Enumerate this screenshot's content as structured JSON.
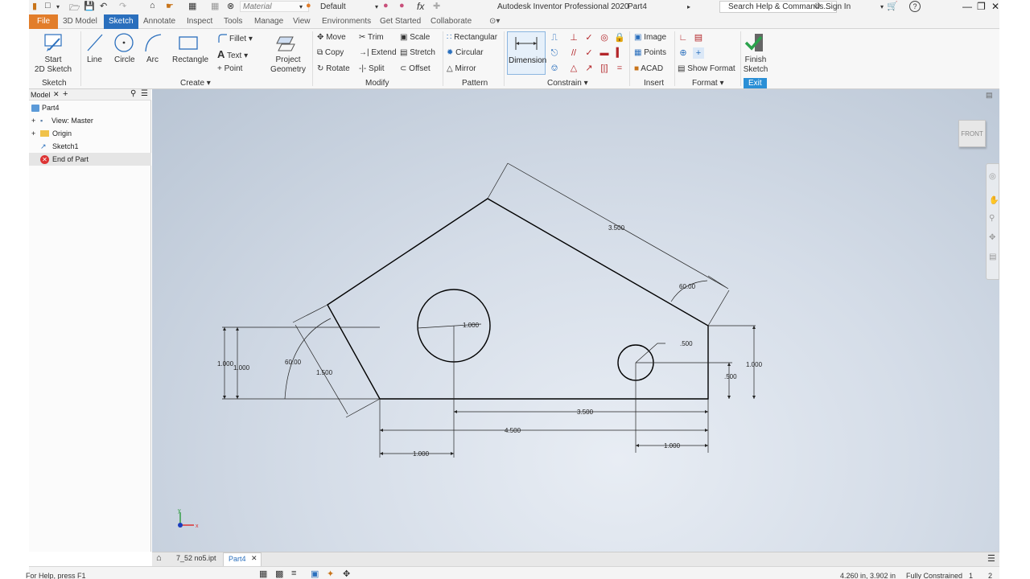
{
  "titlebar": {
    "material": "Material",
    "appearance": "Default",
    "fx": "fx",
    "title": "Autodesk Inventor Professional 2020",
    "document": "Part4",
    "search_placeholder": "Search Help & Commands...",
    "sign_in": "Sign In",
    "help": "?"
  },
  "tabs": [
    "File",
    "3D Model",
    "Sketch",
    "Annotate",
    "Inspect",
    "Tools",
    "Manage",
    "View",
    "Environments",
    "Get Started",
    "Collaborate"
  ],
  "ribbon": {
    "sketch_group": {
      "start_label": "Start",
      "start_label2": "2D Sketch",
      "label": "Sketch"
    },
    "create_group": {
      "line": "Line",
      "circle": "Circle",
      "arc": "Arc",
      "rectangle": "Rectangle",
      "fillet": "Fillet",
      "text": "Text",
      "point": "Point",
      "project": "Project",
      "geometry": "Geometry",
      "label": "Create"
    },
    "modify_group": {
      "move": "Move",
      "trim": "Trim",
      "scale": "Scale",
      "copy": "Copy",
      "extend": "Extend",
      "stretch": "Stretch",
      "rotate": "Rotate",
      "split": "Split",
      "offset": "Offset",
      "label": "Modify"
    },
    "pattern_group": {
      "rectangular": "Rectangular",
      "circular": "Circular",
      "mirror": "Mirror",
      "label": "Pattern"
    },
    "constrain_group": {
      "dimension": "Dimension",
      "label": "Constrain"
    },
    "insert_group": {
      "image": "Image",
      "points": "Points",
      "acad": "ACAD",
      "label": "Insert"
    },
    "format_group": {
      "show_format": "Show Format",
      "label": "Format"
    },
    "exit_group": {
      "finish": "Finish",
      "sketch": "Sketch",
      "label": "Exit"
    }
  },
  "browser": {
    "tab": "Model",
    "items": [
      {
        "label": "Part4"
      },
      {
        "label": "View: Master"
      },
      {
        "label": "Origin"
      },
      {
        "label": "Sketch1"
      },
      {
        "label": "End of Part"
      }
    ]
  },
  "viewcube": {
    "face": "FRONT"
  },
  "sketch": {
    "dims": {
      "d_3500_slant": "3.500",
      "d_60_right": "60.00",
      "d_1000_hole_dia": "1.000",
      "d_500_hole_dia": ".500",
      "d_1000_left_a": "1.000",
      "d_1000_left_b": "1.000",
      "d_60_left": "60.00",
      "d_1500": "1.500",
      "d_500_right": ".500",
      "d_1000_right": "1.000",
      "d_3500_bottom": "3.500",
      "d_4500": "4.500",
      "d_1000_bottom_left": "1.000",
      "d_1000_bottom_right": "1.000"
    }
  },
  "axes": {
    "x": "x",
    "y": "y"
  },
  "doctabs": [
    "7_52 no5.ipt",
    "Part4"
  ],
  "statusbar": {
    "help": "For Help, press F1",
    "coords": "4.260 in, 3.902 in",
    "constraint": "Fully Constrained",
    "num1": "1",
    "num2": "2"
  }
}
